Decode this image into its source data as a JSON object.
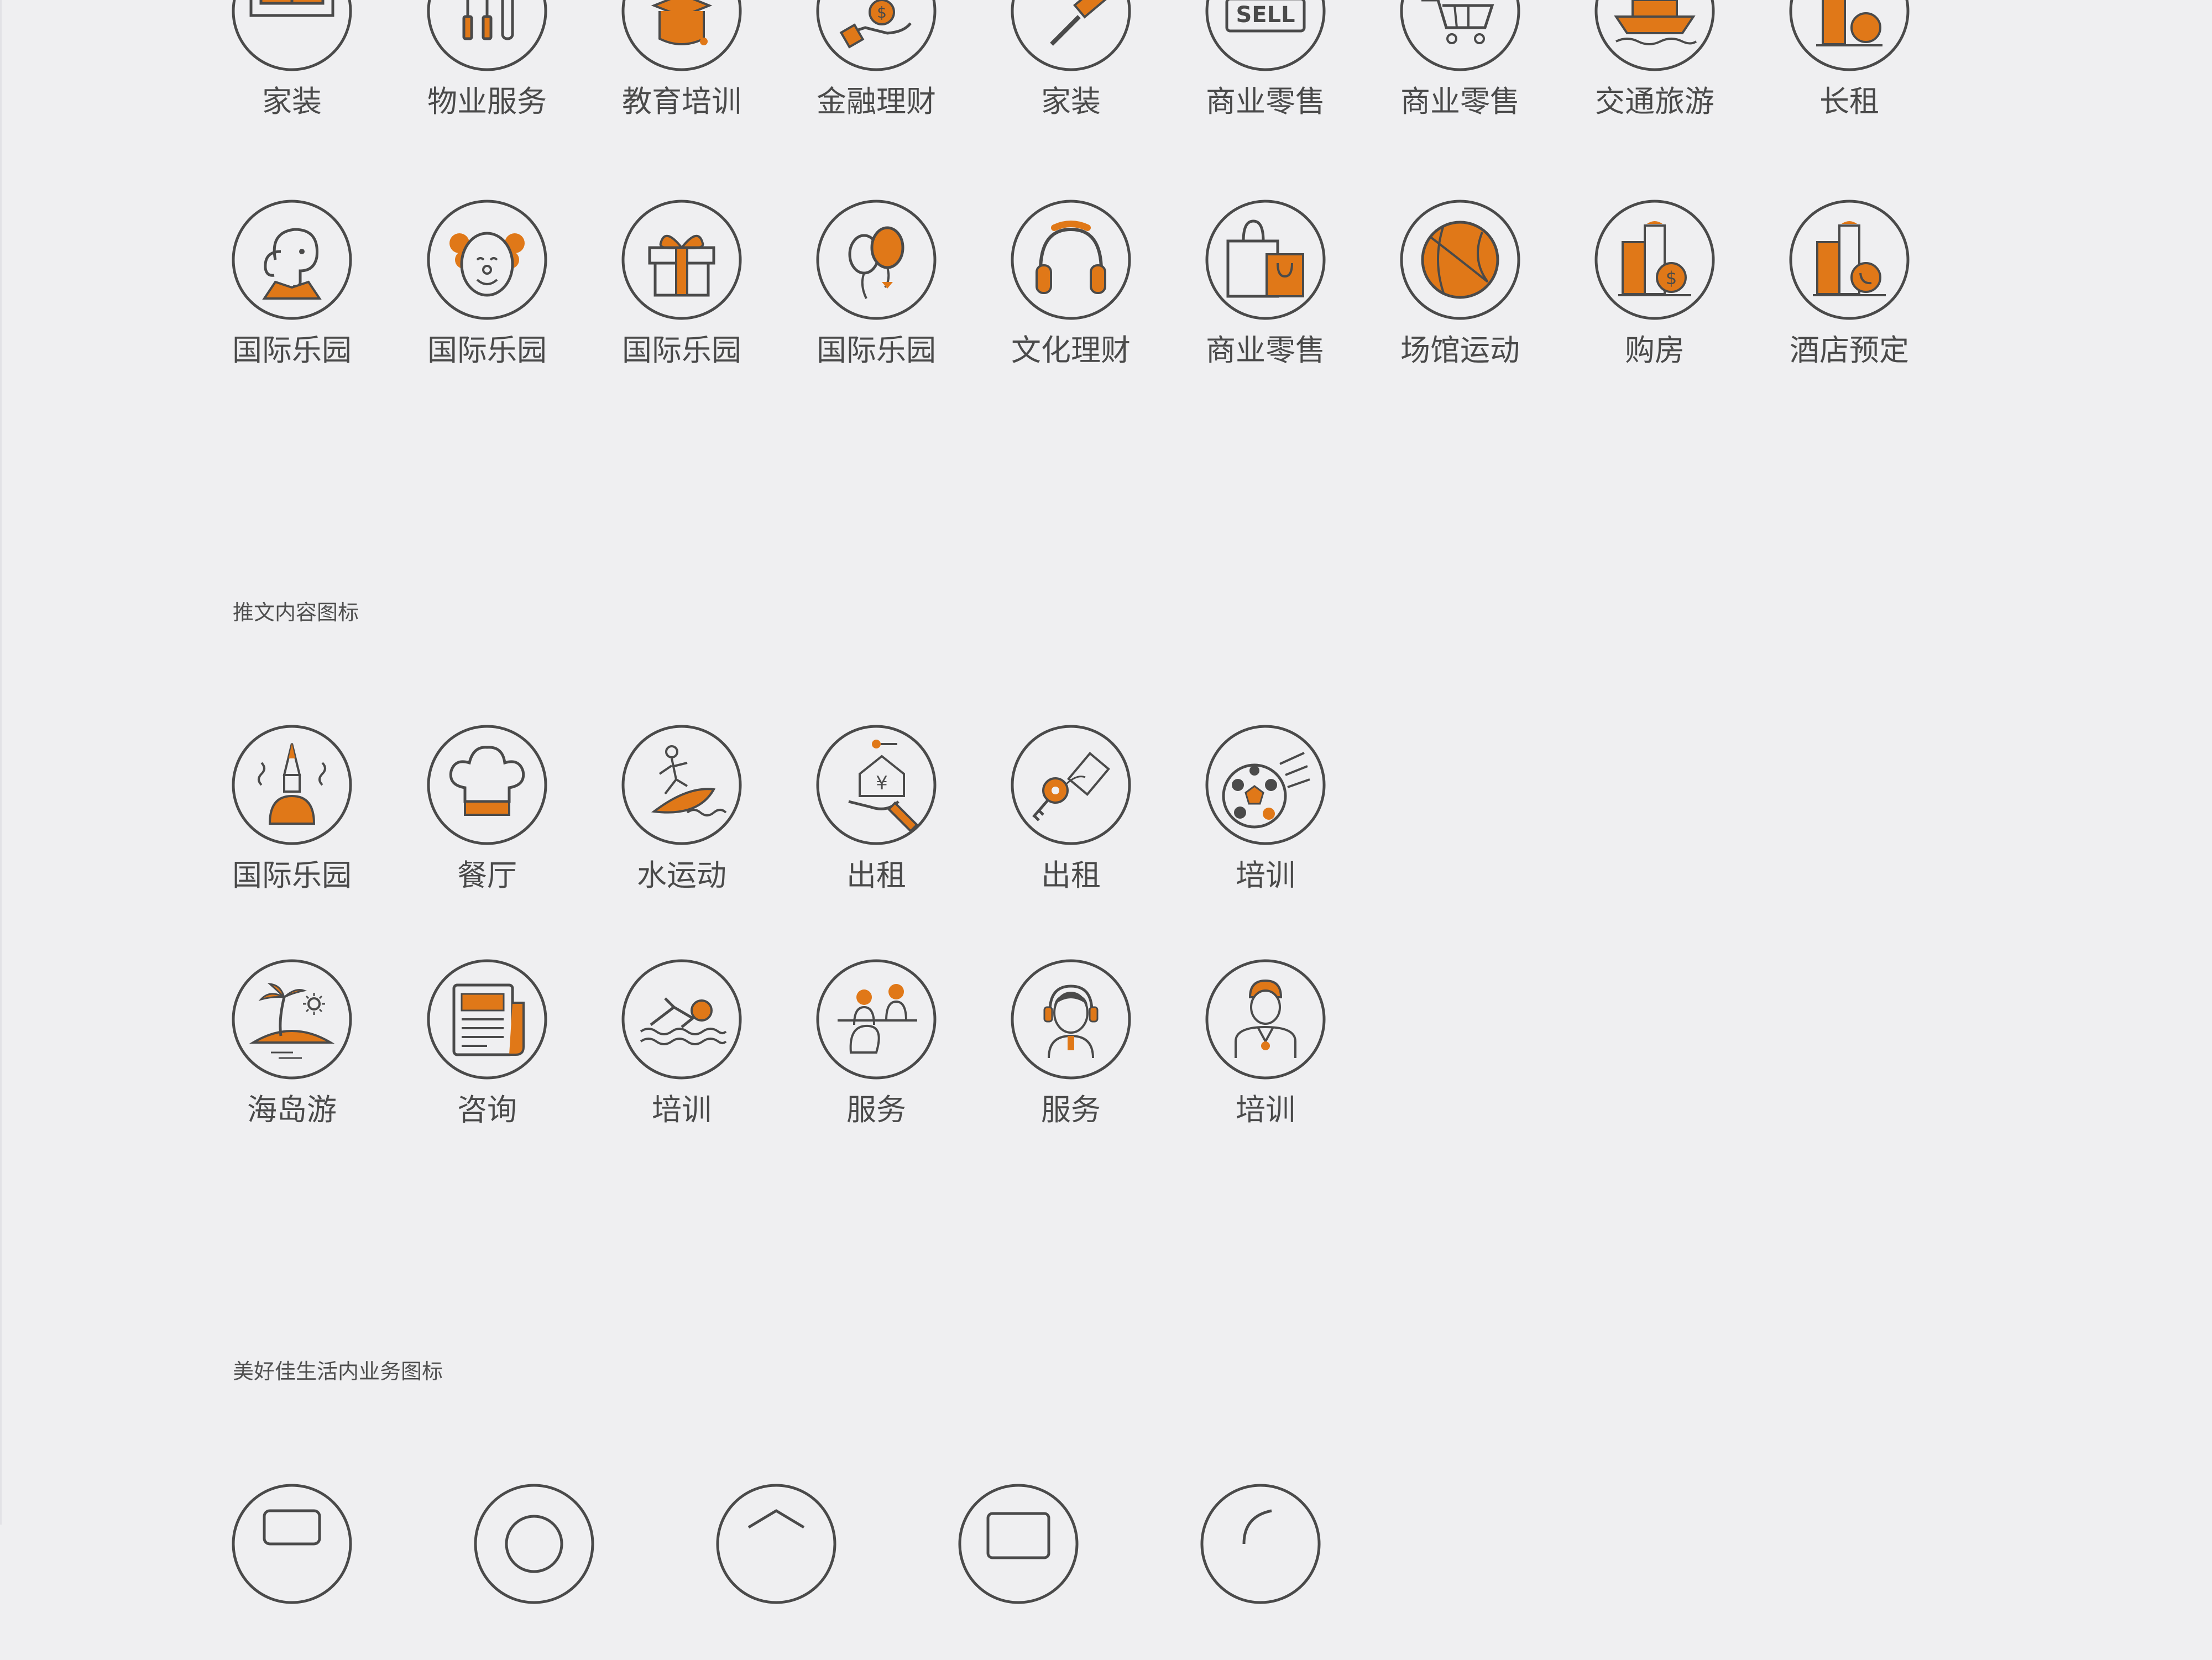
{
  "colors": {
    "background": "#efeff1",
    "accent": "#e07818",
    "outline": "#4a4a4a",
    "text": "#4a4a4a"
  },
  "sections": {
    "content_icons_title": "推文内容图标",
    "business_icons_title": "美好佳生活内业务图标"
  },
  "row1": [
    {
      "label": "家装",
      "icon": "sofa-icon"
    },
    {
      "label": "物业服务",
      "icon": "tools-icon"
    },
    {
      "label": "教育培训",
      "icon": "graduation-cap-icon"
    },
    {
      "label": "金融理财",
      "icon": "hand-coin-icon"
    },
    {
      "label": "家装",
      "icon": "paint-roller-icon"
    },
    {
      "label": "商业零售",
      "icon": "sell-sign-icon"
    },
    {
      "label": "商业零售",
      "icon": "shopping-cart-icon"
    },
    {
      "label": "交通旅游",
      "icon": "ship-icon"
    },
    {
      "label": "长租",
      "icon": "building-icon"
    }
  ],
  "row2": [
    {
      "label": "国际乐园",
      "icon": "elephant-icon"
    },
    {
      "label": "国际乐园",
      "icon": "clown-icon"
    },
    {
      "label": "国际乐园",
      "icon": "gift-box-icon"
    },
    {
      "label": "国际乐园",
      "icon": "balloons-icon"
    },
    {
      "label": "文化理财",
      "icon": "headphones-icon"
    },
    {
      "label": "商业零售",
      "icon": "shopping-bag-icon"
    },
    {
      "label": "场馆运动",
      "icon": "basketball-icon"
    },
    {
      "label": "购房",
      "icon": "building-dollar-icon"
    },
    {
      "label": "酒店预定",
      "icon": "building-phone-icon"
    }
  ],
  "row3": [
    {
      "label": "国际乐园",
      "icon": "party-person-icon"
    },
    {
      "label": "餐厅",
      "icon": "chef-hat-icon"
    },
    {
      "label": "水运动",
      "icon": "surfer-icon"
    },
    {
      "label": "出租",
      "icon": "house-hand-icon"
    },
    {
      "label": "出租",
      "icon": "key-tag-icon"
    },
    {
      "label": "培训",
      "icon": "soccer-ball-icon"
    }
  ],
  "row4": [
    {
      "label": "海岛游",
      "icon": "palm-island-icon"
    },
    {
      "label": "咨询",
      "icon": "newspaper-icon"
    },
    {
      "label": "培训",
      "icon": "swimmer-icon"
    },
    {
      "label": "服务",
      "icon": "people-icon"
    },
    {
      "label": "服务",
      "icon": "headset-agent-icon"
    },
    {
      "label": "培训",
      "icon": "coach-icon"
    }
  ]
}
